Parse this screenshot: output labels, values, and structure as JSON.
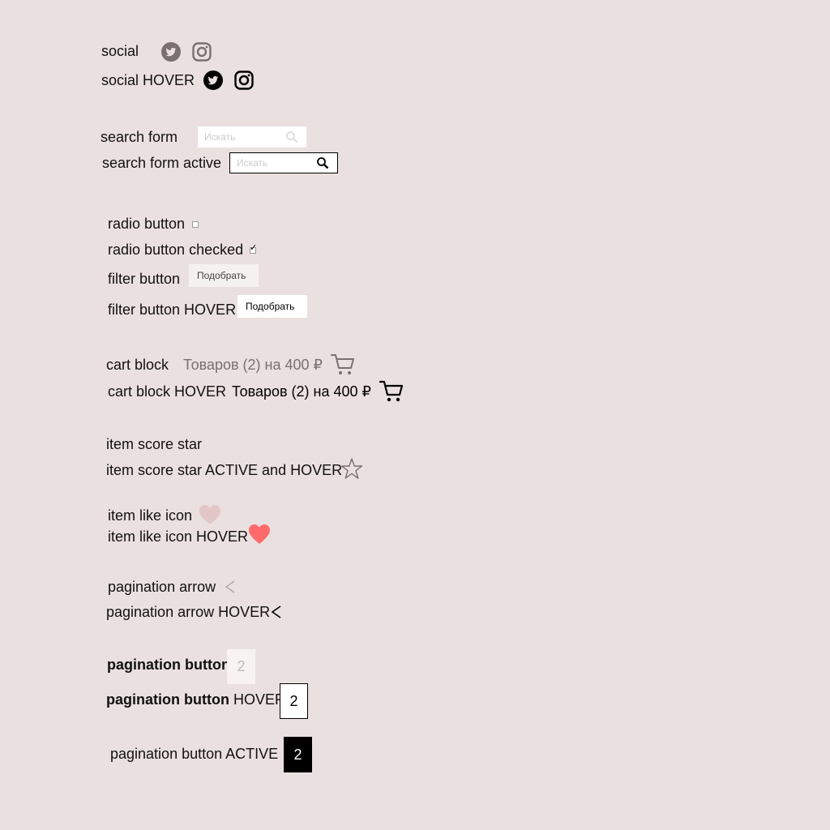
{
  "social": {
    "label": "social",
    "hover_label": "social HOVER",
    "icons": [
      "twitter-icon",
      "instagram-icon"
    ],
    "color": "#7b6f6f",
    "hover_color": "#000000"
  },
  "search": {
    "label": "search form",
    "active_label": "search form active",
    "placeholder": "Искать",
    "icon": "search-icon"
  },
  "radio": {
    "label": "radio button",
    "checked_label": "radio button checked",
    "check_glyph": "✓"
  },
  "filter": {
    "label": "filter button",
    "hover_label": "filter button HOVER",
    "button_text": "Подобрать"
  },
  "cart": {
    "label": "cart block",
    "hover_label": "cart block HOVER",
    "text": "Товаров (2) на 400 ₽",
    "icon": "cart-icon",
    "color": "#7b6f6f",
    "hover_color": "#000000"
  },
  "star": {
    "label": "item score star",
    "active_label": "item score star ACTIVE and HOVER",
    "icon": "star-icon"
  },
  "like": {
    "label": "item like icon",
    "hover_label": "item like icon HOVER",
    "icon": "heart-icon",
    "color": "#e3c7c7",
    "hover_color": "#ff6b6b"
  },
  "pagination_arrow": {
    "label": "pagination arrow",
    "hover_label": "pagination arrow HOVER",
    "icon": "chevron-left-icon"
  },
  "pagination_button": {
    "label_bold": "pagination button",
    "hover_label_rest": "HOVER",
    "active_label": "pagination button ACTIVE",
    "page": "2"
  }
}
